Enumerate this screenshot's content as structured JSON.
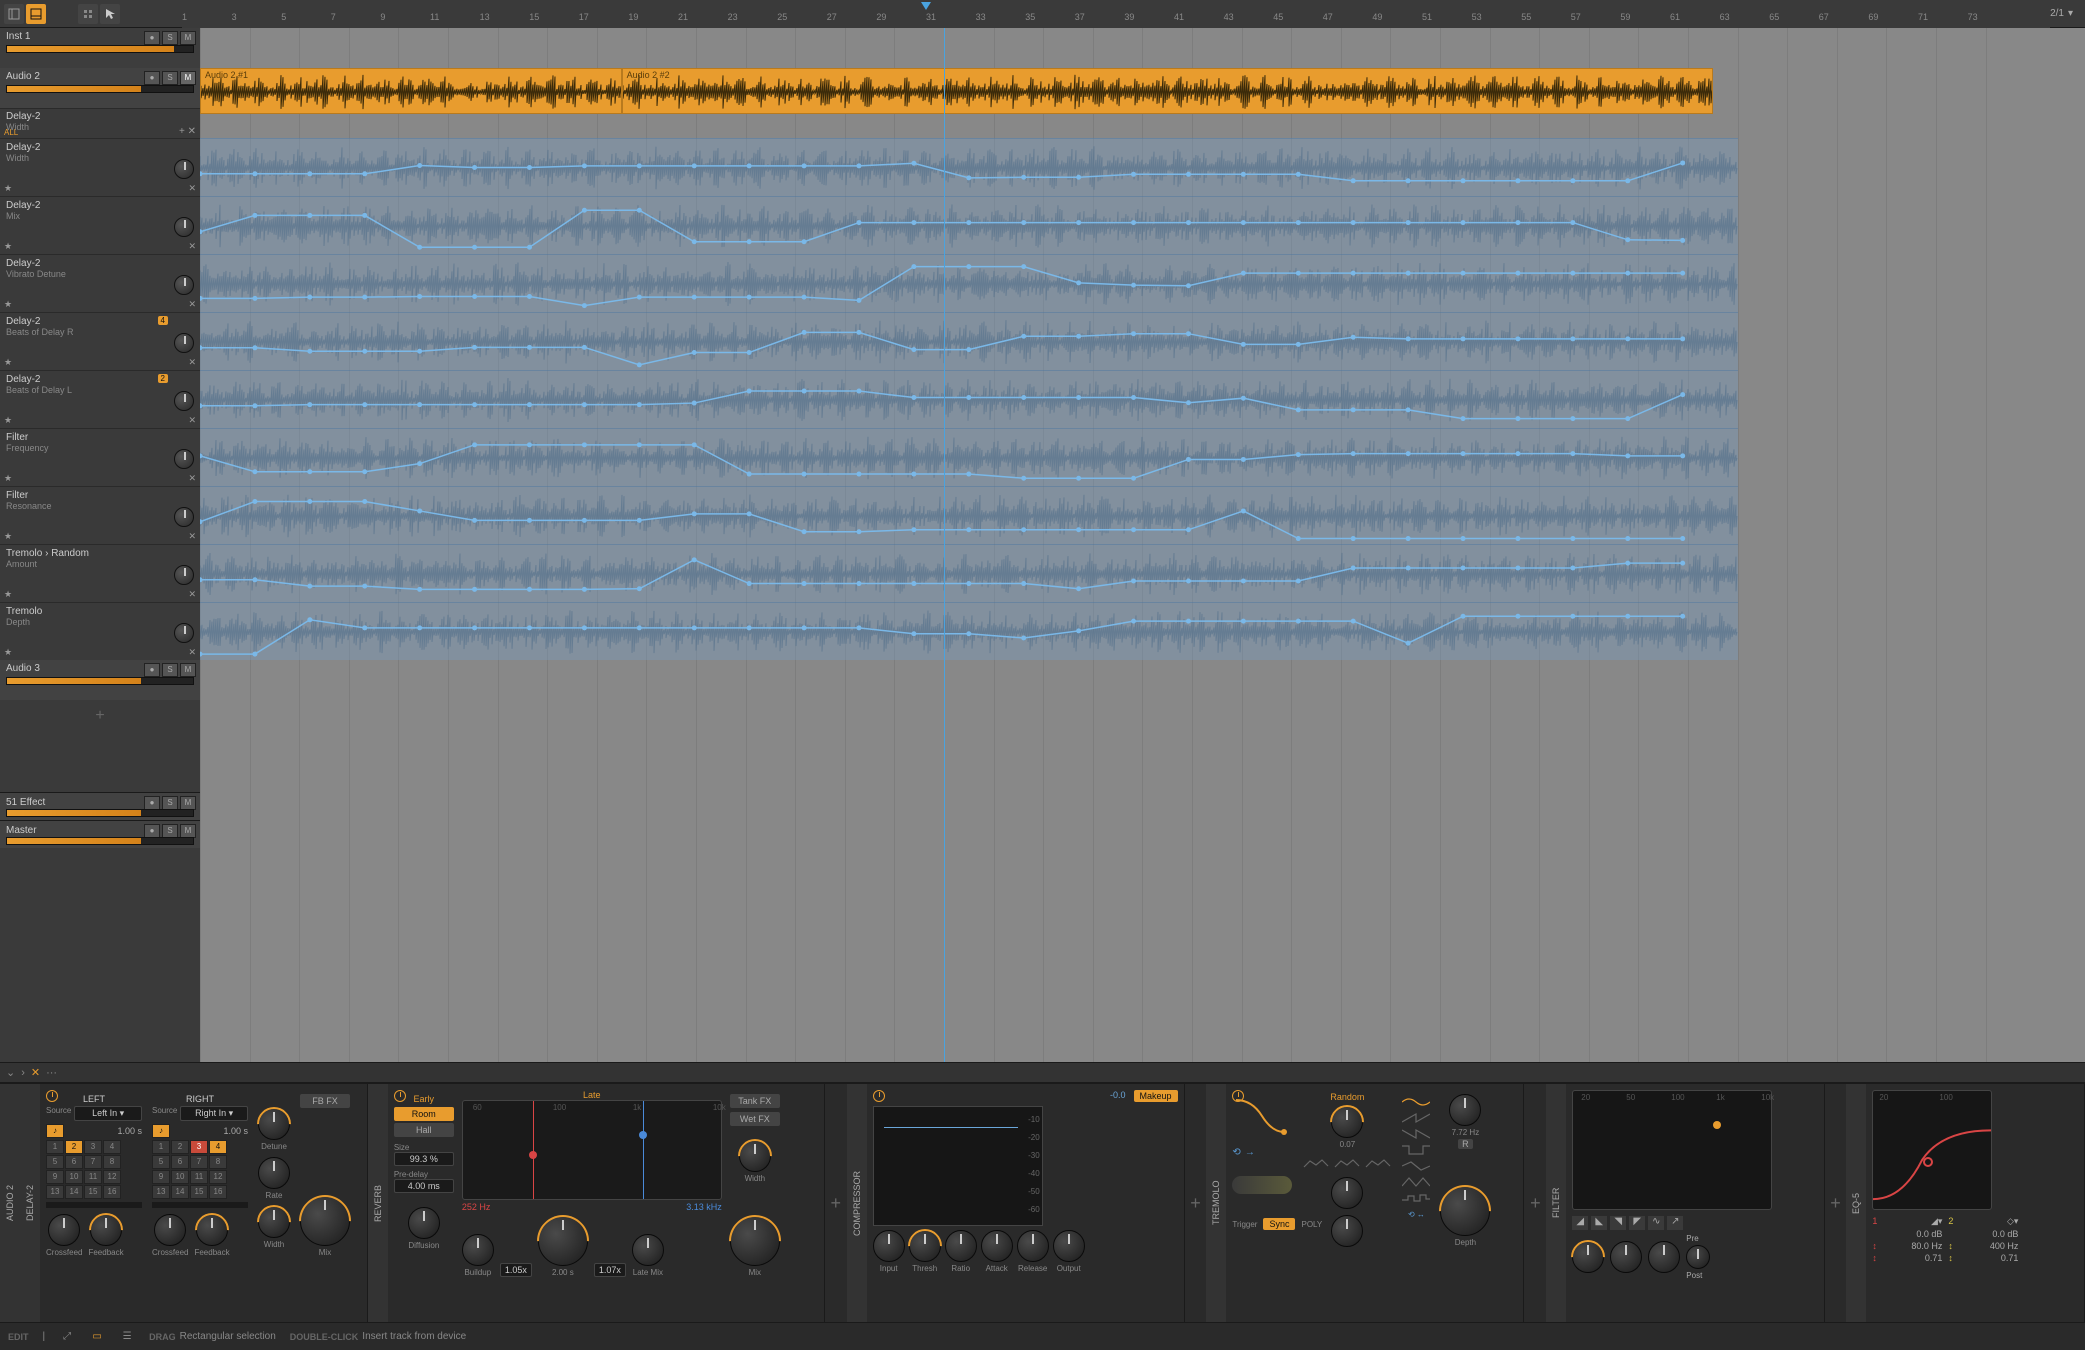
{
  "toolbar": {
    "zoom_display": "2/1"
  },
  "ruler": {
    "ticks": [
      1,
      3,
      5,
      7,
      9,
      11,
      13,
      15,
      17,
      19,
      21,
      23,
      25,
      27,
      29,
      31,
      33,
      35,
      37,
      39,
      41,
      43,
      45,
      47,
      49,
      51,
      53,
      55,
      57,
      59,
      61,
      63,
      65,
      67,
      69,
      71,
      73
    ],
    "playhead_bar": 31
  },
  "tracks": [
    {
      "name": "Inst 1",
      "type": "inst",
      "vol": 0.9
    },
    {
      "name": "Audio 2",
      "type": "audio",
      "vol": 0.72,
      "mute_on": true,
      "clips": [
        {
          "label": "Audio 2 #1",
          "start": 1,
          "end": 18
        },
        {
          "label": "Audio 2 #2",
          "start": 18,
          "end": 62
        }
      ],
      "lanes": [
        {
          "name": "Delay-2",
          "sub": "Width",
          "all": true
        },
        {
          "name": "Delay-2",
          "sub": "Width"
        },
        {
          "name": "Delay-2",
          "sub": "Mix"
        },
        {
          "name": "Delay-2",
          "sub": "Vibrato Detune"
        },
        {
          "name": "Delay-2",
          "sub": "Beats of Delay R",
          "badge": "4"
        },
        {
          "name": "Delay-2",
          "sub": "Beats of Delay L",
          "badge": "2"
        },
        {
          "name": "Filter",
          "sub": "Frequency"
        },
        {
          "name": "Filter",
          "sub": "Resonance"
        },
        {
          "name": "Tremolo › Random",
          "sub": "Amount"
        },
        {
          "name": "Tremolo",
          "sub": "Depth"
        }
      ]
    },
    {
      "name": "Audio 3",
      "type": "audio",
      "vol": 0.72
    }
  ],
  "bus_tracks": [
    {
      "name": "51 Effect",
      "vol": 0.72
    },
    {
      "name": "Master",
      "vol": 0.72
    }
  ],
  "all_label": "ALL",
  "inspector": {
    "expand": "›",
    "more": "···"
  },
  "devices": {
    "delay2": {
      "name": "DELAY-2",
      "left": {
        "title": "LEFT",
        "source_lbl": "Source",
        "source": "Left In",
        "time": "1.00 s",
        "steps": [
          1,
          2,
          3,
          4,
          5,
          6,
          7,
          8,
          9,
          10,
          11,
          12,
          13,
          14,
          15,
          16
        ],
        "on": [
          2
        ],
        "crossfeed": "Crossfeed",
        "feedback": "Feedback"
      },
      "right": {
        "title": "RIGHT",
        "source_lbl": "Source",
        "source": "Right In",
        "time": "1.00 s",
        "steps": [
          1,
          2,
          3,
          4,
          5,
          6,
          7,
          8,
          9,
          10,
          11,
          12,
          13,
          14,
          15,
          16
        ],
        "on": [
          4
        ],
        "alt": [
          3
        ],
        "crossfeed": "Crossfeed",
        "feedback": "Feedback"
      },
      "detune": "Detune",
      "rate": "Rate",
      "width": "Width",
      "mix": "Mix",
      "fbfx": "FB FX"
    },
    "reverb": {
      "name": "REVERB",
      "early": "Early",
      "room": "Room",
      "hall": "Hall",
      "size": "Size",
      "size_val": "99.3 %",
      "predelay": "Pre-delay",
      "predelay_val": "4.00 ms",
      "late": "Late",
      "lo": "252 Hz",
      "hi": "3.13 kHz",
      "diffusion": "Diffusion",
      "buildup": "Buildup",
      "buildup_val": "1.05x",
      "decay_val": "2.00 s",
      "shape_val": "1.07x",
      "latemix": "Late Mix",
      "tankfx": "Tank FX",
      "wetfx": "Wet FX",
      "width": "Width",
      "mix": "Mix",
      "scale": [
        "60",
        "100",
        "1k",
        "10k"
      ]
    },
    "compressor": {
      "name": "COMPRESSOR",
      "gr": "-0.0",
      "makeup": "Makeup",
      "scale": [
        -10,
        -20,
        -30,
        -40,
        -50,
        -60
      ],
      "input": "Input",
      "thresh": "Thresh",
      "ratio": "Ratio",
      "attack": "Attack",
      "release": "Release",
      "output": "Output"
    },
    "tremolo": {
      "name": "TREMOLO",
      "random": "Random",
      "amount": "0.07",
      "trigger": "Trigger",
      "sync": "Sync",
      "poly": "POLY",
      "depth": "Depth",
      "rate": "7.72 Hz",
      "retrigger": "R"
    },
    "filter": {
      "name": "FILTER",
      "pre": "Pre",
      "post": "Post",
      "scale": [
        "20",
        "50",
        "100",
        "1k",
        "10k"
      ]
    },
    "eq5": {
      "name": "EQ-5",
      "scale": [
        "20",
        "100"
      ],
      "band1": {
        "num": "1",
        "gain": "0.0 dB",
        "freq": "80.0 Hz",
        "q": "0.71"
      },
      "band2": {
        "num": "2",
        "gain": "0.0 dB",
        "freq": "400 Hz",
        "q": "0.71"
      }
    }
  },
  "status": {
    "edit": "EDIT",
    "drag": "DRAG",
    "drag_txt": "Rectangular selection",
    "dbl": "DOUBLE-CLICK",
    "dbl_txt": "Insert track from device"
  }
}
